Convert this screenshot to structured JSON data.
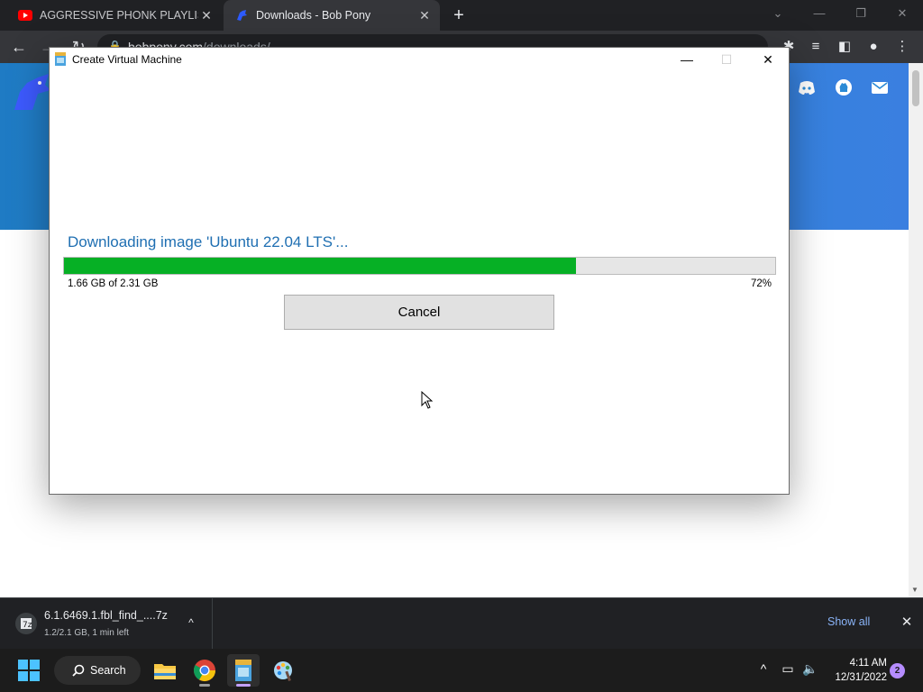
{
  "browser": {
    "tabs": [
      {
        "title": "AGGRESSIVE PHONK PLAYLIST #",
        "favicon": "youtube-icon",
        "active": false
      },
      {
        "title": "Downloads - Bob Pony",
        "favicon": "bob-pony-icon",
        "active": true
      }
    ],
    "address": {
      "domain": "bobpony.com",
      "path": "/downloads/"
    },
    "colors": {
      "tabstrip": "#202124",
      "toolbar": "#35363a"
    }
  },
  "website": {
    "banner_color": "#2b8ad6",
    "social_icons": [
      "discord-icon",
      "github-icon",
      "mail-icon"
    ]
  },
  "dialog": {
    "title": "Create Virtual Machine",
    "status_text": "Downloading image 'Ubuntu 22.04 LTS'...",
    "progress_size_text": "1.66 GB of 2.31 GB",
    "progress_percent_text": "72%",
    "progress_value": 0.72,
    "cancel_label": "Cancel",
    "progress_color": "#06b025",
    "status_color": "#1f6fb2"
  },
  "downloads": {
    "file_name": "6.1.6469.1.fbl_find_....7z",
    "status": "1.2/2.1 GB, 1 min left",
    "show_all_label": "Show all"
  },
  "taskbar": {
    "search_label": "Search",
    "pinned_apps": [
      "file-explorer-icon",
      "chrome-icon",
      "windows-sandbox-icon",
      "paint-icon"
    ],
    "clock_time": "4:11 AM",
    "clock_date": "12/31/2022",
    "notification_count": "2"
  }
}
